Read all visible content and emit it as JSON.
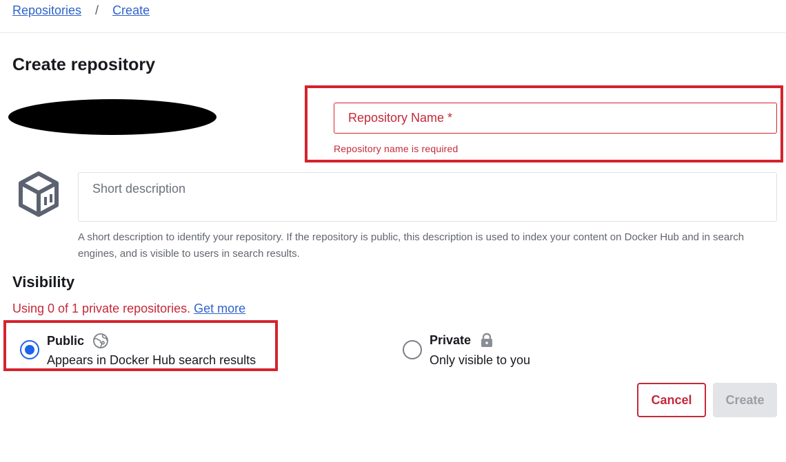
{
  "breadcrumb": {
    "items": [
      "Repositories",
      "Create"
    ],
    "separator": "/"
  },
  "page": {
    "title": "Create repository"
  },
  "repository": {
    "name_placeholder": "Repository Name *",
    "name_value": "",
    "name_error": "Repository name is required",
    "description_placeholder": "Short description",
    "description_value": "",
    "description_help": "A short description to identify your repository. If the repository is public, this description is used to index your content on Docker Hub and in search engines, and is visible to users in search results.",
    "icon": "repository-cube-icon"
  },
  "visibility": {
    "title": "Visibility",
    "usage_text": "Using 0 of 1 private repositories.",
    "usage_link": "Get more",
    "options": [
      {
        "title": "Public",
        "description": "Appears in Docker Hub search results",
        "icon": "globe-icon",
        "selected": true
      },
      {
        "title": "Private",
        "description": "Only visible to you",
        "icon": "lock-icon",
        "selected": false
      }
    ]
  },
  "actions": {
    "cancel_label": "Cancel",
    "create_label": "Create",
    "create_disabled": true
  },
  "colors": {
    "accent": "#1d63ed",
    "error": "#c5283a",
    "highlight": "#d5232d",
    "link": "#2f63c9",
    "disabled_bg": "#e3e4e7"
  }
}
